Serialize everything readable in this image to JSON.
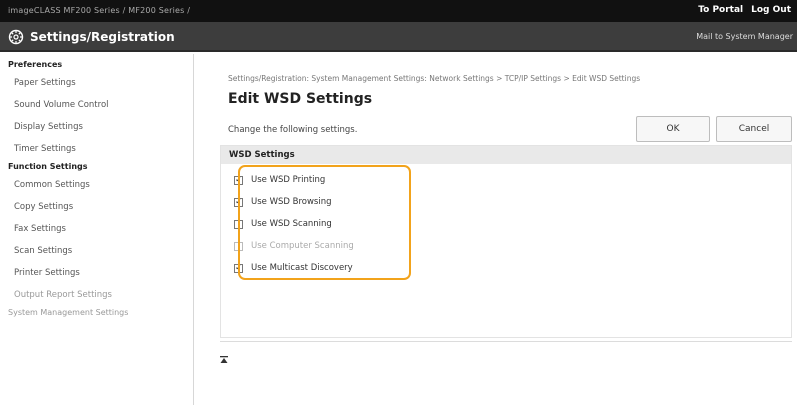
{
  "topbar": {
    "device": "imageCLASS     MF200 Series / MF200 Series /",
    "portal_link": "To Portal",
    "logout_link": "Log Out"
  },
  "titlebar": {
    "title": "Settings/Registration",
    "mail_link": "Mail to System Manager"
  },
  "sidebar": {
    "sections": [
      {
        "heading": "Preferences",
        "items": [
          "Paper Settings",
          "Sound Volume Control",
          "Display Settings",
          "Timer Settings"
        ]
      },
      {
        "heading": "Function Settings",
        "items": [
          "Common Settings",
          "Copy Settings",
          "Fax Settings",
          "Scan Settings",
          "Printer Settings",
          "Output Report Settings"
        ]
      }
    ],
    "footer": "System Management Settings"
  },
  "main": {
    "breadcrumb": "Settings/Registration: System Management Settings: Network Settings > TCP/IP Settings > Edit WSD Settings",
    "title": "Edit WSD Settings",
    "instruction": "Change the following settings.",
    "ok_label": "OK",
    "cancel_label": "Cancel",
    "section_title": "WSD Settings",
    "options": [
      {
        "label": "Use WSD Printing",
        "checked": true,
        "enabled": true
      },
      {
        "label": "Use WSD Browsing",
        "checked": true,
        "enabled": true
      },
      {
        "label": "Use WSD Scanning",
        "checked": false,
        "enabled": true
      },
      {
        "label": "Use Computer Scanning",
        "checked": false,
        "enabled": false
      },
      {
        "label": "Use Multicast Discovery",
        "checked": true,
        "enabled": true
      }
    ]
  },
  "colors": {
    "highlight": "#f2a31b",
    "titlebar": "#3d3d3d",
    "topbar": "#111111"
  },
  "icons": {
    "settings": "gear-icon",
    "to_top": "to-top-icon"
  }
}
